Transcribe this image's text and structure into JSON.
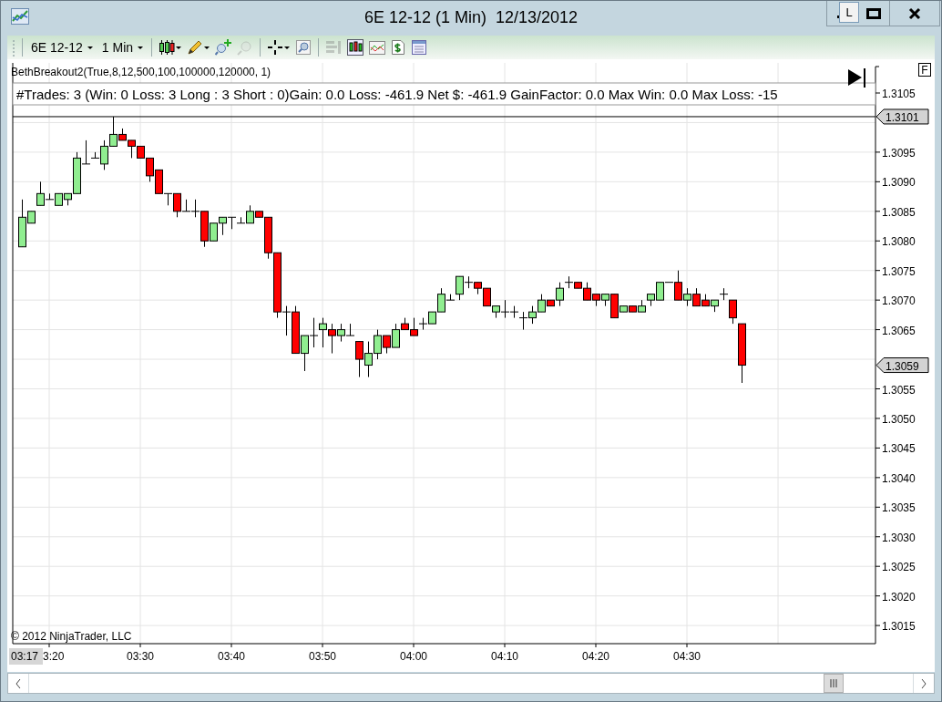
{
  "window": {
    "title": "6E 12-12 (1 Min)  12/13/2012",
    "hint": "L"
  },
  "toolbar": {
    "items": [
      {
        "kind": "grip"
      },
      {
        "kind": "separator"
      },
      {
        "kind": "dropdown",
        "label": "6E 12-12"
      },
      {
        "kind": "dropdown",
        "label": "1 Min"
      },
      {
        "kind": "separator"
      },
      {
        "kind": "candles",
        "has_menu": true,
        "disabled": false
      },
      {
        "kind": "pencil",
        "has_menu": true,
        "disabled": false
      },
      {
        "kind": "zoomin",
        "has_menu": false,
        "disabled": false
      },
      {
        "kind": "zoomout",
        "has_menu": false,
        "disabled": true
      },
      {
        "kind": "separator"
      },
      {
        "kind": "crosshair",
        "has_menu": true,
        "disabled": false
      },
      {
        "kind": "magnifier",
        "has_menu": false,
        "disabled": false
      },
      {
        "kind": "separator"
      },
      {
        "kind": "databox",
        "has_menu": false,
        "disabled": true
      },
      {
        "kind": "candlechart",
        "has_menu": false,
        "disabled": false
      },
      {
        "kind": "linechart",
        "has_menu": false,
        "disabled": false
      },
      {
        "kind": "dollar",
        "has_menu": false,
        "disabled": false
      },
      {
        "kind": "properties",
        "has_menu": false,
        "disabled": false
      }
    ]
  },
  "chart": {
    "indicator": "BethBreakout2(True,8,12,500,100,100000,120000, 1)",
    "stats": "#Trades: 3 (Win: 0 Loss: 3 Long : 3 Short : 0)Gain: 0.0 Loss: -461.9 Net $: -461.9 GainFactor: 0.0 Max Win: 0.0 Max Loss: -15",
    "panel_button": "F",
    "y_labels": [
      "1.3105",
      "1.3095",
      "1.3090",
      "1.3085",
      "1.3080",
      "1.3075",
      "1.3070",
      "1.3065",
      "1.3055",
      "1.3050",
      "1.3045",
      "1.3040",
      "1.3035",
      "1.3030",
      "1.3025",
      "1.3020",
      "1.3015"
    ],
    "price_markers": [
      {
        "label": "1.3101",
        "kind": "line"
      },
      {
        "label": "1.3059",
        "kind": "last"
      }
    ],
    "start_marker": "03:17",
    "first_label": "3:20",
    "x_labels": [
      "03:30",
      "03:40",
      "03:50",
      "04:00",
      "04:10",
      "04:20",
      "04:30"
    ],
    "copyright": "© 2012 NinjaTrader, LLC"
  }
}
